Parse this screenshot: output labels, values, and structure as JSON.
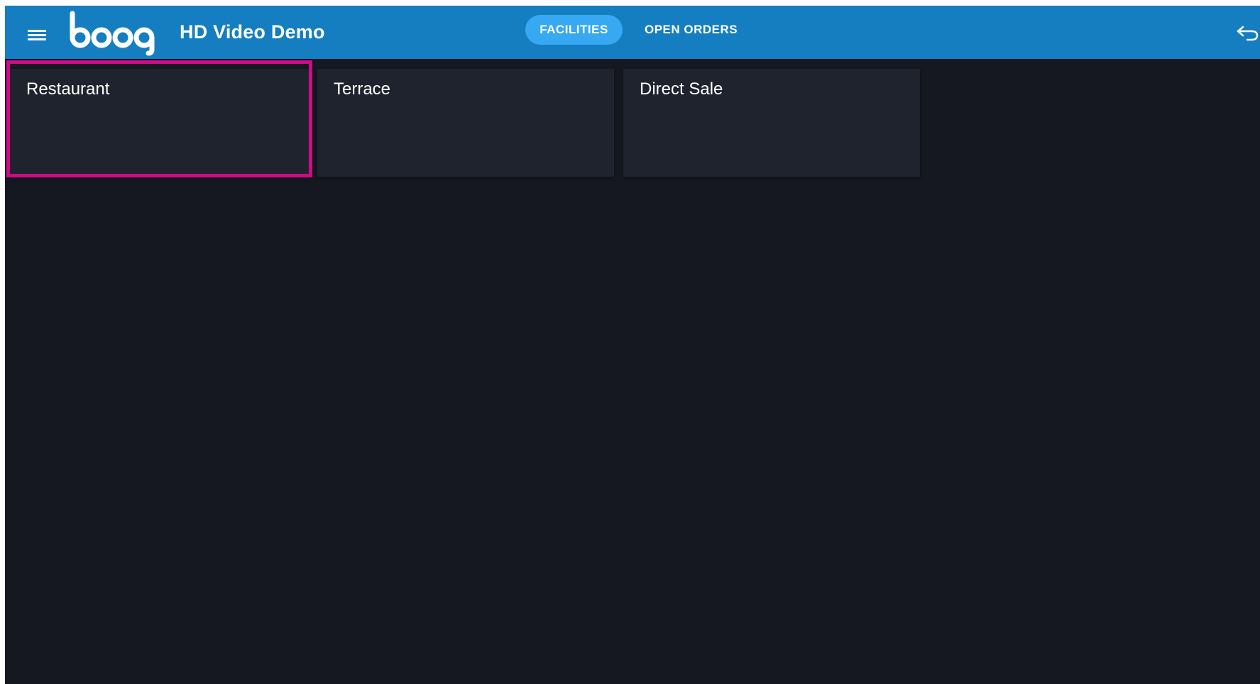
{
  "header": {
    "app_name": "HD Video Demo",
    "logo_text": "booq",
    "menu_icon": "hamburger-menu-icon",
    "back_icon": "return-arrow-icon",
    "tabs": [
      {
        "label": "FACILITIES",
        "active": true
      },
      {
        "label": "OPEN ORDERS",
        "active": false
      }
    ]
  },
  "facilities": [
    {
      "name": "Restaurant",
      "highlighted": true
    },
    {
      "name": "Terrace",
      "highlighted": false
    },
    {
      "name": "Direct Sale",
      "highlighted": false
    }
  ],
  "colors": {
    "header_bg": "#147ec1",
    "active_tab_bg": "#37a8f2",
    "app_bg": "#151821",
    "card_bg": "#1f232d",
    "highlight_border": "#cf0b86"
  }
}
